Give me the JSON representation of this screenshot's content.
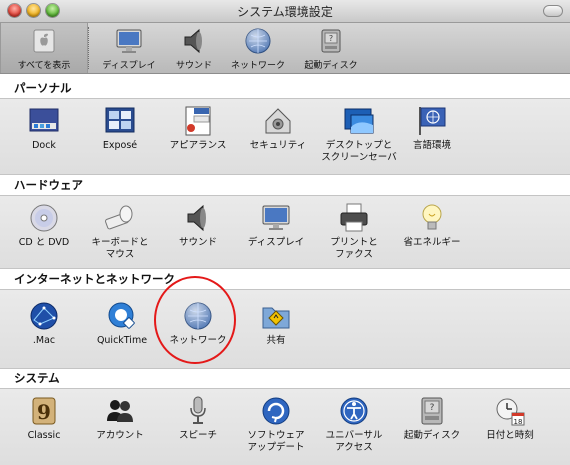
{
  "window": {
    "title": "システム環境設定"
  },
  "toolbar": {
    "items": [
      {
        "label": "すべてを表示",
        "icon": "apple-grid-icon"
      },
      {
        "label": "ディスプレイ",
        "icon": "display-icon"
      },
      {
        "label": "サウンド",
        "icon": "speaker-icon"
      },
      {
        "label": "ネットワーク",
        "icon": "network-globe-icon"
      },
      {
        "label": "起動ディスク",
        "icon": "startup-disk-icon"
      }
    ]
  },
  "sections": [
    {
      "title": "パーソナル",
      "panes": [
        {
          "label": "Dock",
          "icon": "dock-icon"
        },
        {
          "label": "Exposé",
          "icon": "expose-icon"
        },
        {
          "label": "アピアランス",
          "icon": "appearance-icon"
        },
        {
          "label": "セキュリティ",
          "icon": "security-house-icon"
        },
        {
          "label": "デスクトップと\nスクリーンセーバ",
          "icon": "desktop-screensaver-icon"
        },
        {
          "label": "言語環境",
          "icon": "international-flag-icon"
        }
      ]
    },
    {
      "title": "ハードウェア",
      "panes": [
        {
          "label": "CD と DVD",
          "icon": "cd-dvd-icon"
        },
        {
          "label": "キーボードと\nマウス",
          "icon": "keyboard-mouse-icon"
        },
        {
          "label": "サウンド",
          "icon": "speaker-icon"
        },
        {
          "label": "ディスプレイ",
          "icon": "display-icon"
        },
        {
          "label": "プリントと\nファクス",
          "icon": "printer-icon"
        },
        {
          "label": "省エネルギー",
          "icon": "lightbulb-icon"
        }
      ]
    },
    {
      "title": "インターネットとネットワーク",
      "panes": [
        {
          "label": ".Mac",
          "icon": "dotmac-icon"
        },
        {
          "label": "QuickTime",
          "icon": "quicktime-icon"
        },
        {
          "label": "ネットワーク",
          "icon": "network-globe-icon"
        },
        {
          "label": "共有",
          "icon": "sharing-folder-icon"
        }
      ]
    },
    {
      "title": "システム",
      "panes": [
        {
          "label": "Classic",
          "icon": "classic-icon"
        },
        {
          "label": "アカウント",
          "icon": "accounts-icon"
        },
        {
          "label": "スピーチ",
          "icon": "speech-mic-icon"
        },
        {
          "label": "ソフトウェア\nアップデート",
          "icon": "software-update-icon"
        },
        {
          "label": "ユニバーサル\nアクセス",
          "icon": "universal-access-icon"
        },
        {
          "label": "起動ディスク",
          "icon": "startup-disk-icon"
        },
        {
          "label": "日付と時刻",
          "icon": "date-time-icon"
        }
      ]
    }
  ],
  "colors": {
    "annotation_circle": "#e41919"
  }
}
